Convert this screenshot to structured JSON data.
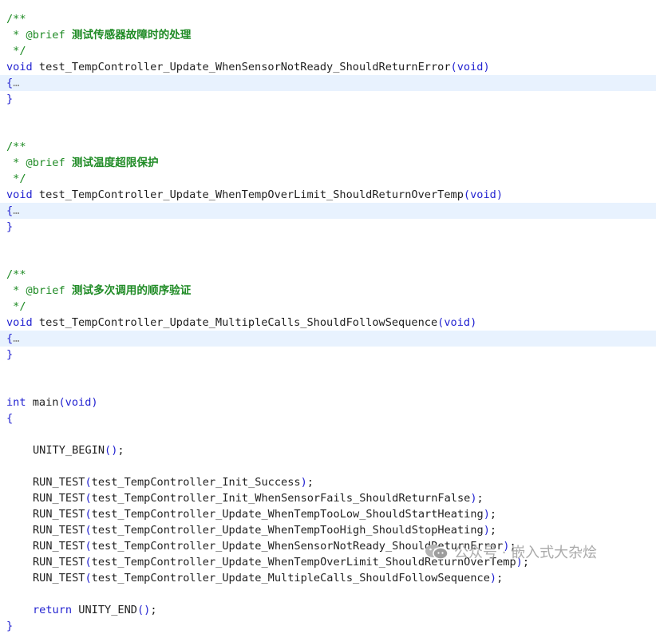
{
  "code": {
    "block1": {
      "open": "/**",
      "brief_tag": " * @brief ",
      "brief_text": "测试传感器故障时的处理",
      "close": " */",
      "ret_type": "void",
      "func_name": " test_TempController_Update_WhenSensorNotReady_ShouldReturnError",
      "params": "(void)",
      "brace_open": "{",
      "ellipsis": "…",
      "brace_close": "}"
    },
    "block2": {
      "open": "/**",
      "brief_tag": " * @brief ",
      "brief_text": "测试温度超限保护",
      "close": " */",
      "ret_type": "void",
      "func_name": " test_TempController_Update_WhenTempOverLimit_ShouldReturnOverTemp",
      "params": "(void)",
      "brace_open": "{",
      "ellipsis": "…",
      "brace_close": "}"
    },
    "block3": {
      "open": "/**",
      "brief_tag": " * @brief ",
      "brief_text": "测试多次调用的顺序验证",
      "close": " */",
      "ret_type": "void",
      "func_name": " test_TempController_Update_MultipleCalls_ShouldFollowSequence",
      "params": "(void)",
      "brace_open": "{",
      "ellipsis": "…",
      "brace_close": "}"
    },
    "main": {
      "ret_type": "int",
      "func_name": " main",
      "params": "(void)",
      "brace_open": "{",
      "begin_call": "UNITY_BEGIN",
      "begin_parens": "()",
      "semicolon": ";",
      "run_tests": [
        {
          "macro": "RUN_TEST",
          "lp": "(",
          "arg": "test_TempController_Init_Success",
          "rp": ")",
          "end": ";"
        },
        {
          "macro": "RUN_TEST",
          "lp": "(",
          "arg": "test_TempController_Init_WhenSensorFails_ShouldReturnFalse",
          "rp": ")",
          "end": ";"
        },
        {
          "macro": "RUN_TEST",
          "lp": "(",
          "arg": "test_TempController_Update_WhenTempTooLow_ShouldStartHeating",
          "rp": ")",
          "end": ";"
        },
        {
          "macro": "RUN_TEST",
          "lp": "(",
          "arg": "test_TempController_Update_WhenTempTooHigh_ShouldStopHeating",
          "rp": ")",
          "end": ";"
        },
        {
          "macro": "RUN_TEST",
          "lp": "(",
          "arg": "test_TempController_Update_WhenSensorNotReady_ShouldReturnError",
          "rp": ")",
          "end": ";"
        },
        {
          "macro": "RUN_TEST",
          "lp": "(",
          "arg": "test_TempController_Update_WhenTempOverLimit_ShouldReturnOverTemp",
          "rp": ")",
          "end": ";"
        },
        {
          "macro": "RUN_TEST",
          "lp": "(",
          "arg": "test_TempController_Update_MultipleCalls_ShouldFollowSequence",
          "rp": ")",
          "end": ";"
        }
      ],
      "return_kw": "return",
      "end_call": " UNITY_END",
      "end_parens": "()",
      "end_semicolon": ";",
      "brace_close": "}"
    }
  },
  "watermark": {
    "icon": "wechat-icon",
    "text": "公众号 · 嵌入式大杂烩"
  },
  "colors": {
    "comment": "#1f8b25",
    "keyword": "#2323d1",
    "identifier": "#1f1f1f",
    "fold_highlight": "#e8f2fe",
    "watermark": "#aaaaaa"
  }
}
